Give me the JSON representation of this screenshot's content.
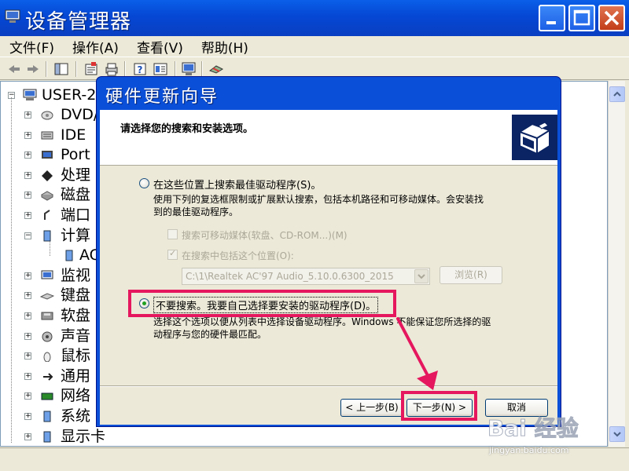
{
  "window": {
    "title": "设备管理器",
    "colors": {
      "titlebar": "#0a4fd8",
      "client": "#ece9d8",
      "highlight": "#e5175e"
    }
  },
  "menu": [
    {
      "label": "文件(F)"
    },
    {
      "label": "操作(A)"
    },
    {
      "label": "查看(V)"
    },
    {
      "label": "帮助(H)"
    }
  ],
  "toolbar": [
    "back-arrow-icon",
    "forward-arrow-icon",
    "show-hide-tree-icon",
    "properties-icon",
    "print-icon",
    "help-icon",
    "view-icon",
    "scan-hardware-icon",
    "uninstall-icon"
  ],
  "tree": {
    "root": "USER-2",
    "items": [
      {
        "label": "DVD/",
        "icon": "dvd-drive-icon"
      },
      {
        "label": "IDE",
        "icon": "ide-controller-icon"
      },
      {
        "label": "Port",
        "icon": "port-icon"
      },
      {
        "label": "处理",
        "icon": "processor-icon"
      },
      {
        "label": "磁盘",
        "icon": "disk-drive-icon"
      },
      {
        "label": "端口",
        "icon": "port-connector-icon"
      },
      {
        "label": "计算",
        "icon": "computer-icon",
        "expanded": true
      },
      {
        "label": "AC",
        "icon": "computer-child-icon",
        "child": true
      },
      {
        "label": "监视",
        "icon": "monitor-icon"
      },
      {
        "label": "键盘",
        "icon": "keyboard-icon"
      },
      {
        "label": "软盘",
        "icon": "floppy-icon"
      },
      {
        "label": "声音",
        "icon": "sound-icon"
      },
      {
        "label": "鼠标",
        "icon": "mouse-icon"
      },
      {
        "label": "通用",
        "icon": "usb-icon"
      },
      {
        "label": "网络",
        "icon": "network-icon"
      },
      {
        "label": "系统",
        "icon": "system-icon"
      },
      {
        "label": "显示卡",
        "icon": "display-adapter-icon"
      }
    ]
  },
  "dialog": {
    "title": "硬件更新向导",
    "header": "请选择您的搜索和安装选项。",
    "option1": {
      "label": "在这些位置上搜索最佳驱动程序(S)。",
      "desc_line1": "使用下列的复选框限制或扩展默认搜索，包括本机路径和可移动媒体。会安装找",
      "desc_line2": "到的最佳驱动程序。",
      "check1": "搜索可移动媒体(软盘、CD-ROM...)(M)",
      "check2": "在搜索中包括这个位置(O):",
      "path": "C:\\1\\Realtek AC'97 Audio_5.10.0.6300_2015",
      "browse": "浏览(R)"
    },
    "option2": {
      "label": "不要搜索。我要自己选择要安装的驱动程序(D)。",
      "desc_line1": "选择这个选项以便从列表中选择设备驱动程序。Windows 不能保证您所选择的驱",
      "desc_line2": "动程序与您的硬件最匹配。"
    },
    "buttons": {
      "back": "< 上一步(B)",
      "next": "下一步(N) >",
      "cancel": "取消"
    }
  },
  "watermark": {
    "logo": "Bai 经验",
    "url": "jingyan.baidu.com"
  }
}
